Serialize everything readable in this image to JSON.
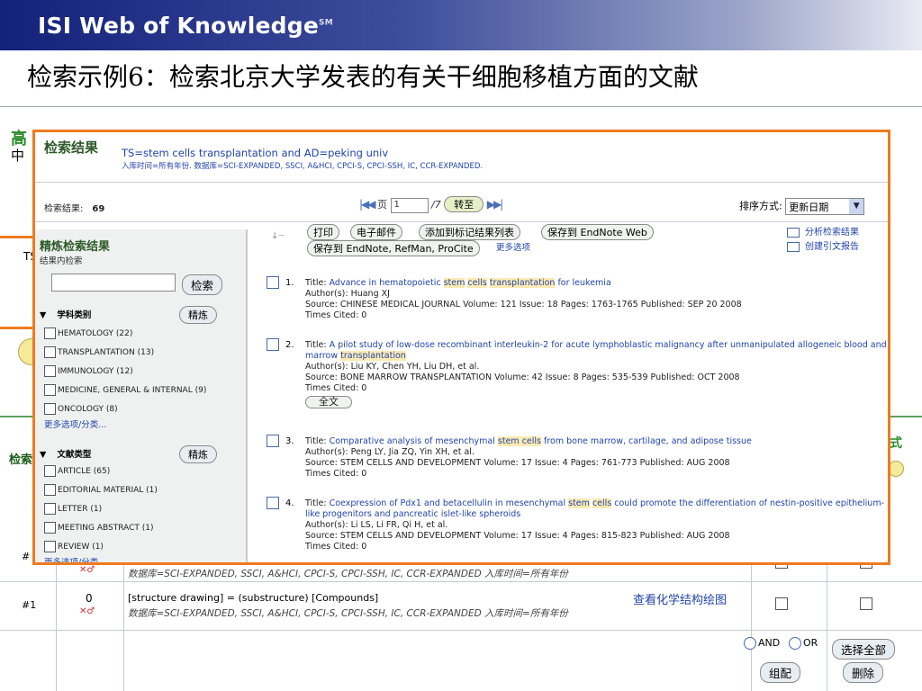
{
  "banner": {
    "brand": "ISI Web of Knowledge",
    "tm": "SM"
  },
  "slide_title": "检索示例6：检索北京大学发表的有关干细胞移植方面的文献",
  "background": {
    "left_green_head": "高",
    "left_zhong": "中",
    "ts_fragment": "TS",
    "jian": "检索",
    "right_fragment": "式",
    "rows": [
      {
        "num": "#1",
        "count": "0",
        "mol": "✕♂",
        "query": "[structure drawing] = (substructure) [Compounds]",
        "db": "数据库=SCI-EXPANDED, SSCI, A&HCI, CPCI-S, CPCI-SSH, IC, CCR-EXPANDED 入库时间=所有年份",
        "link": "查看化学结构绘图"
      },
      {
        "num": "#",
        "count": "",
        "mol": "✕♂",
        "query": "",
        "db": "数据库=SCI-EXPANDED, SSCI, A&HCI, CPCI-S, CPCI-SSH, IC, CCR-EXPANDED 入库时间=所有年份",
        "link": ""
      }
    ],
    "and_label": "AND",
    "or_label": "OR",
    "select_all": "选择全部",
    "combine": "组配",
    "delete": "删除"
  },
  "results": {
    "title": "检索结果",
    "query": "TS=stem cells transplantation and AD=peking univ",
    "query_sub": "入库时间=所有年份. 数据库=SCI-EXPANDED, SSCI, A&HCI, CPCI-S, CPCI-SSH, IC, CCR-EXPANDED.",
    "count_label": "检索结果:",
    "count": "69",
    "page_label": "页",
    "page_value": "1",
    "page_total": "/7",
    "goto": "转至",
    "sort_label": "排序方式:",
    "sort_value": "更新日期"
  },
  "refine": {
    "title": "精炼检索结果",
    "search_within": "结果内检索",
    "search_button": "检索",
    "refine_button": "精炼",
    "subject": {
      "label": "学科类别",
      "items": [
        "HEMATOLOGY (22)",
        "TRANSPLANTATION (13)",
        "IMMUNOLOGY (12)",
        "MEDICINE, GENERAL & INTERNAL (9)",
        "ONCOLOGY (8)"
      ],
      "more": "更多选项/分类..."
    },
    "doctype": {
      "label": "文献类型",
      "items": [
        "ARTICLE (65)",
        "EDITORIAL MATERIAL (1)",
        "LETTER (1)",
        "MEETING ABSTRACT (1)",
        "REVIEW (1)"
      ],
      "more": "更多选项/分类..."
    }
  },
  "actions": {
    "print": "打印",
    "email": "电子邮件",
    "add_marked": "添加到标记结果列表",
    "save_to": "保存到 EndNote Web",
    "save_to2": "保存到 EndNote, RefMan, ProCite",
    "more": "更多选项",
    "analyze": "分析检索结果",
    "citation_report": "创建引文报告"
  },
  "records": [
    {
      "n": "1.",
      "title_pre": "Advance in hematopoietic ",
      "hl1": "stem",
      "mid1": " ",
      "hl2": "cells",
      "mid2": " ",
      "hl3": "transplantation",
      "title_post": " for leukemia",
      "authors": "Author(s): Huang XJ",
      "source": "Source: CHINESE MEDICAL JOURNAL   Volume: 121   Issue: 18   Pages: 1763-1765   Published: SEP 20 2008",
      "cited": "Times Cited: 0",
      "fulltext": ""
    },
    {
      "n": "2.",
      "title_pre": "A pilot study of low-dose recombinant interleukin-2 for acute lymphoblastic malignancy after unmanipulated allogeneic blood and marrow ",
      "hl3": "transplantation",
      "title_post": "",
      "authors": "Author(s): Liu KY, Chen YH, Liu DH, et al.",
      "source": "Source: BONE MARROW TRANSPLANTATION   Volume: 42   Issue: 8   Pages: 535-539   Published: OCT 2008",
      "cited": "Times Cited: 0",
      "fulltext": "全文"
    },
    {
      "n": "3.",
      "title_pre": "Comparative analysis of mesenchymal ",
      "hl1": "stem cells",
      "title_post": " from bone marrow, cartilage, and adipose tissue",
      "authors": "Author(s): Peng LY, Jia ZQ, Yin XH, et al.",
      "source": "Source: STEM CELLS AND DEVELOPMENT   Volume: 17   Issue: 4   Pages: 761-773   Published: AUG 2008",
      "cited": "Times Cited: 0",
      "fulltext": ""
    },
    {
      "n": "4.",
      "title_pre": "Coexpression of Pdx1 and betacellulin in mesenchymal ",
      "hl1": "stem",
      "mid1": " ",
      "hl2": "cells",
      "title_post": " could promote the differentiation of nestin-positive epithelium-like progenitors and pancreatic islet-like spheroids",
      "authors": "Author(s): Li LS, Li FR, Qi H, et al.",
      "source": "Source: STEM CELLS AND DEVELOPMENT   Volume: 17   Issue: 4   Pages: 815-823   Published: AUG 2008",
      "cited": "Times Cited: 0",
      "fulltext": ""
    }
  ],
  "record_labels": {
    "title": "Title:"
  },
  "colors": {
    "accent_orange": "#f07a1f",
    "link_blue": "#2244aa",
    "banner_blue": "#13217b",
    "highlight": "#fbeab2"
  }
}
